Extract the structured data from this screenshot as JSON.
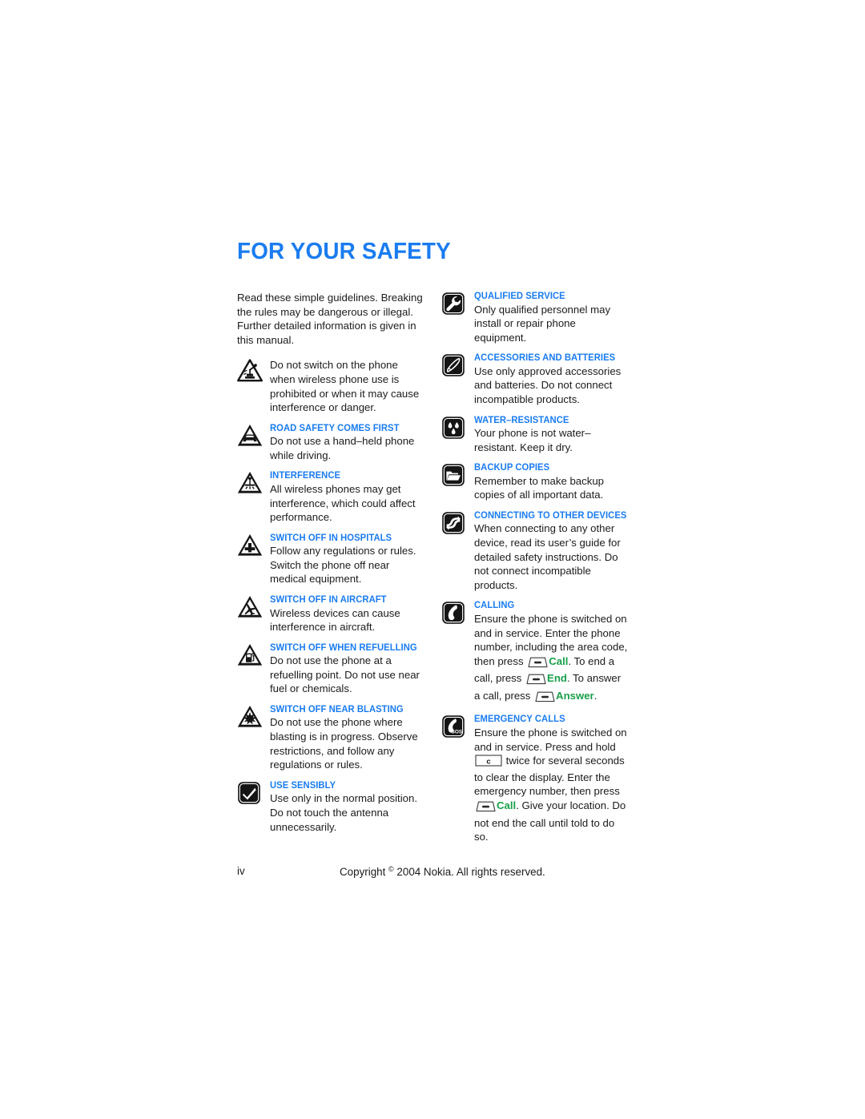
{
  "page": {
    "title": "FOR YOUR SAFETY",
    "intro": "Read these simple guidelines. Breaking the rules may be dangerous or illegal. Further detailed information is given in this manual."
  },
  "left_column": [
    {
      "icon": "warning-triangle-no-phone-icon",
      "heading": "",
      "text": "Do not switch on the phone when wireless phone use is prohibited or when it may cause interference or danger."
    },
    {
      "icon": "warning-triangle-car-icon",
      "heading": "ROAD SAFETY COMES FIRST",
      "text": "Do not use a hand–held phone while driving."
    },
    {
      "icon": "warning-triangle-interference-icon",
      "heading": "INTERFERENCE",
      "text": "All wireless phones may get interference, which could affect performance."
    },
    {
      "icon": "warning-triangle-hospital-cross-icon",
      "heading": "SWITCH OFF IN HOSPITALS",
      "text": "Follow any regulations or rules. Switch the phone off near medical equipment."
    },
    {
      "icon": "warning-triangle-aircraft-icon",
      "heading": "SWITCH OFF IN AIRCRAFT",
      "text": "Wireless devices can cause interference in aircraft."
    },
    {
      "icon": "warning-triangle-fuel-pump-icon",
      "heading": "SWITCH OFF WHEN REFUELLING",
      "text": "Do not use the phone at a refuelling point. Do not use near fuel or chemicals."
    },
    {
      "icon": "warning-triangle-blasting-icon",
      "heading": "SWITCH OFF NEAR BLASTING",
      "text": "Do not use the phone where blasting is in progress. Observe restrictions, and follow any regulations or rules."
    },
    {
      "icon": "checkmark-square-icon",
      "heading": "USE SENSIBLY",
      "text": "Use only in the normal position. Do not touch the antenna unnecessarily."
    }
  ],
  "right_column": [
    {
      "icon": "wrench-square-icon",
      "heading": "QUALIFIED SERVICE",
      "text": "Only qualified personnel may install or repair phone equipment."
    },
    {
      "icon": "accessories-pen-square-icon",
      "heading": "ACCESSORIES AND BATTERIES",
      "text": "Use only approved accessories and batteries. Do not connect incompatible products."
    },
    {
      "icon": "water-droplets-square-icon",
      "heading": "WATER–RESISTANCE",
      "text": "Your phone is not water–resistant. Keep it dry."
    },
    {
      "icon": "folder-square-icon",
      "heading": "BACKUP COPIES",
      "text": "Remember to make backup copies of all important data."
    },
    {
      "icon": "connect-devices-square-icon",
      "heading": "CONNECTING TO OTHER DEVICES",
      "text": "When connecting to any other device, read its user’s guide for detailed safety instructions. Do not connect incompatible products."
    },
    {
      "icon": "phone-handset-square-icon",
      "heading": "CALLING",
      "text": ""
    },
    {
      "icon": "emergency-sos-phone-square-icon",
      "heading": "EMERGENCY CALLS",
      "text": ""
    }
  ],
  "calling_text": {
    "part1": "Ensure the phone is switched on and in service. Enter the phone number, including the area code, then press",
    "key1_label": "Call",
    "part2": ". To end a call, press",
    "key2_label": "End",
    "part3": ". To answer a call, press",
    "key3_label": "Answer",
    "part4": "."
  },
  "emergency_text": {
    "part1": "Ensure the phone is switched on and in service. Press and hold",
    "clear_key_label": "c",
    "part2": "twice for several seconds to clear the display. Enter the emergency number, then press",
    "call_key_label": "Call",
    "part3": ". Give your location. Do not end the call until told to do so."
  },
  "footer": {
    "page_number": "iv",
    "copyright_prefix": "Copyright",
    "copyright_mark": "©",
    "copyright_rest": "2004 Nokia. All rights reserved."
  },
  "colors": {
    "heading_blue": "#1a7cf0",
    "key_green": "#18a04a",
    "body_text": "#1b1b1b",
    "icon_black": "#151515"
  }
}
